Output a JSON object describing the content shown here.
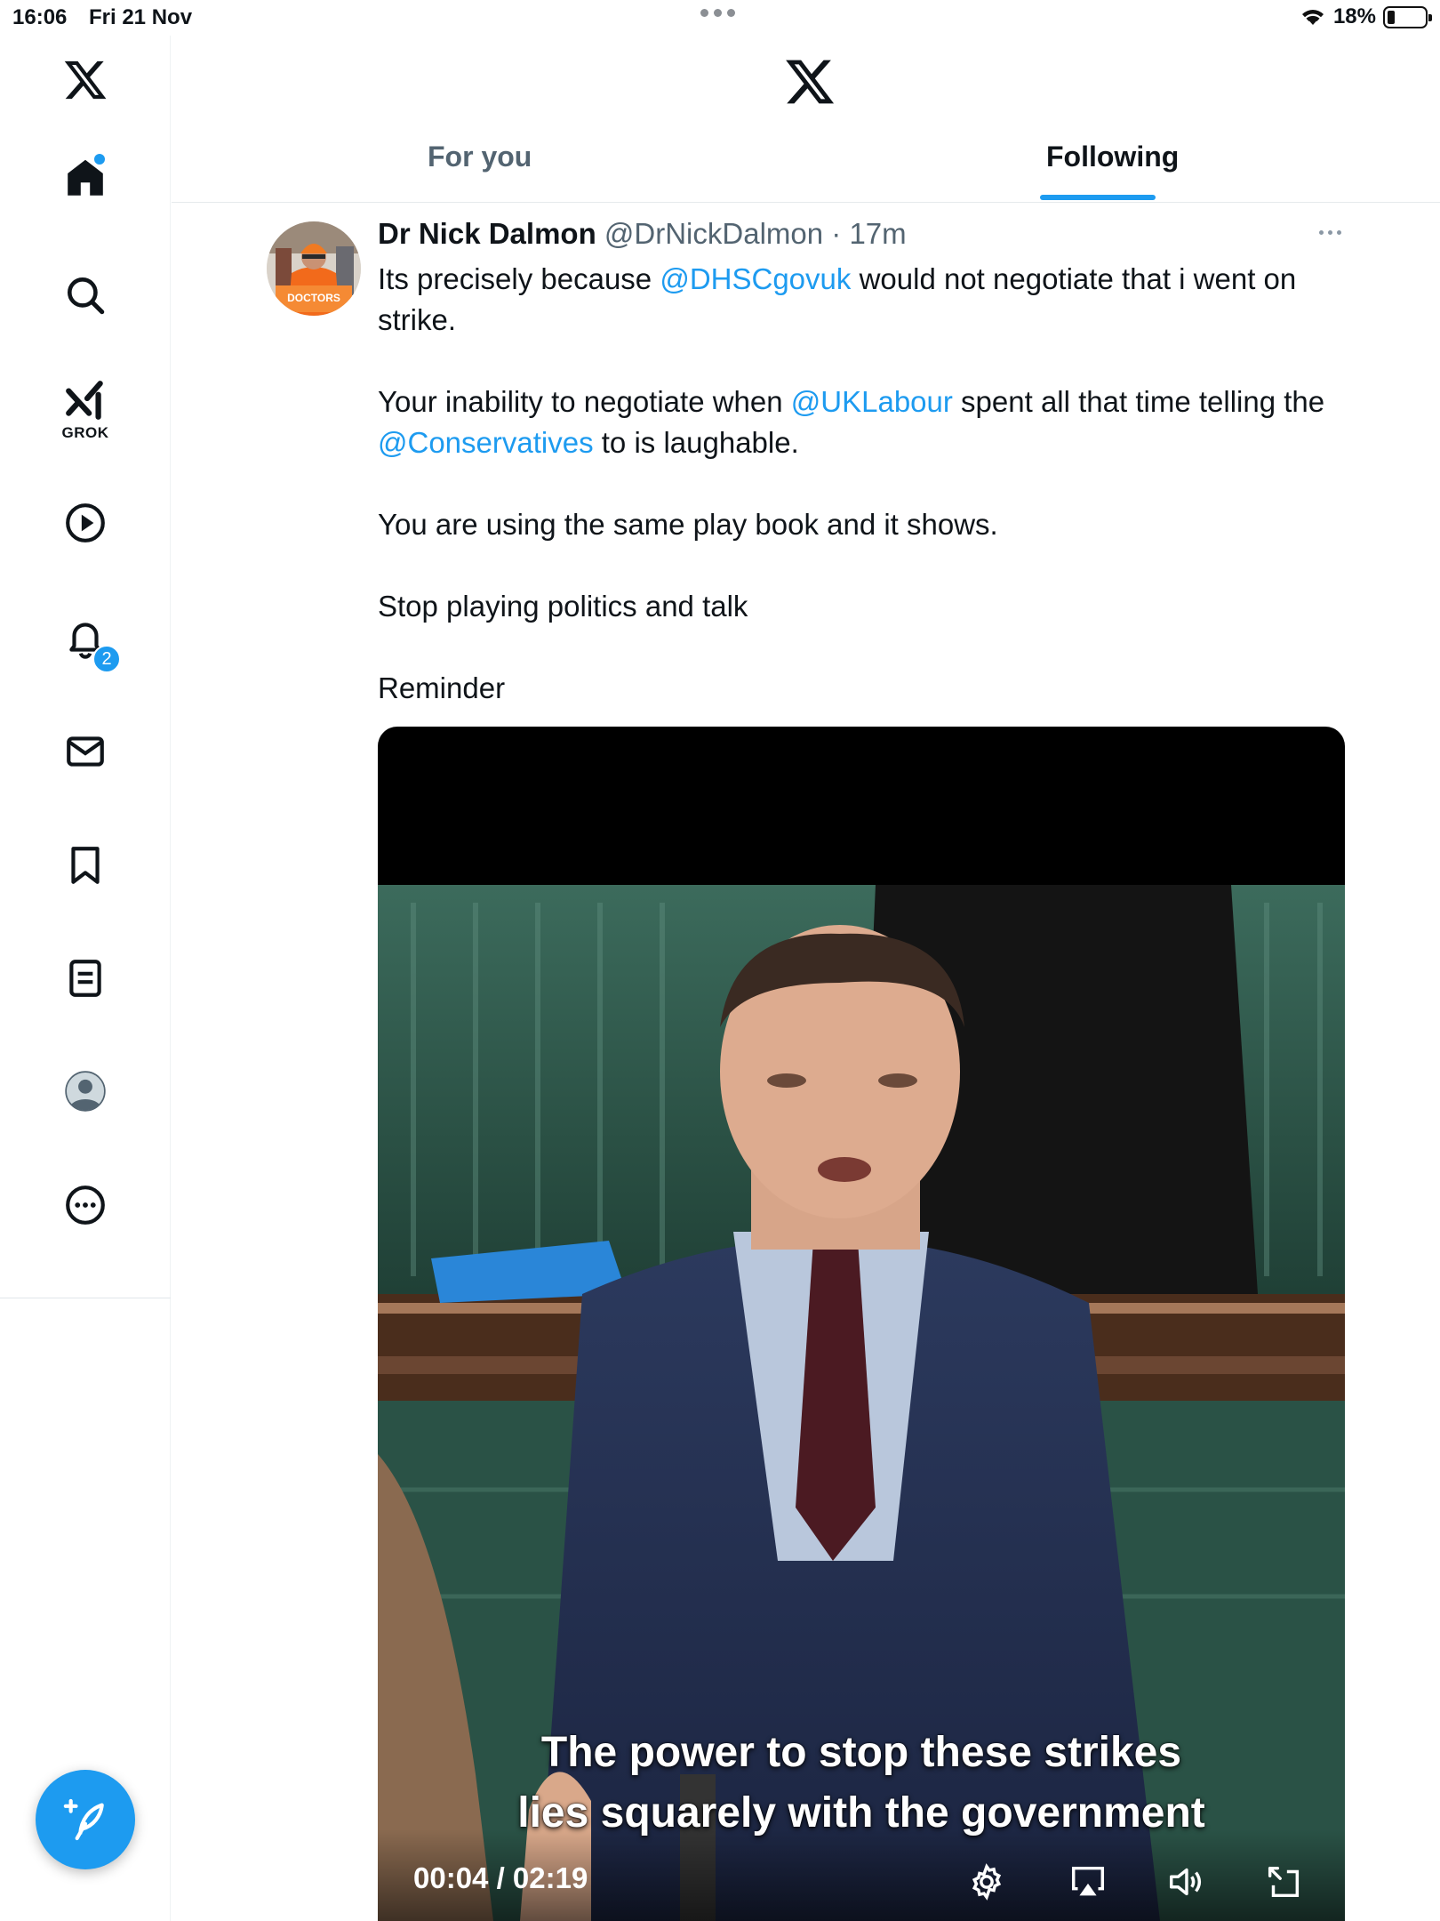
{
  "status_bar": {
    "time": "16:06",
    "date": "Fri 21 Nov",
    "battery": "18%"
  },
  "sidebar": {
    "grok_label": "GROK",
    "notification_count": "2"
  },
  "tabs": [
    {
      "label": "For you",
      "selected": false
    },
    {
      "label": "Following",
      "selected": true
    }
  ],
  "tweet": {
    "author_name": "Dr Nick Dalmon",
    "handle": "@DrNickDalmon",
    "separator": "·",
    "time": "17m",
    "text": {
      "p1_before": "Its precisely because ",
      "p1_mention": "@DHSCgovuk",
      "p1_after": " would not negotiate that i went on strike.",
      "p2_before": "Your inability to negotiate when ",
      "p2_mention1": "@UKLabour",
      "p2_middle": " spent all that time telling the ",
      "p2_mention2": "@Conservatives",
      "p2_after": " to is laughable.",
      "p3": "You are using the same play book and it shows.",
      "p4": "Stop playing politics and talk",
      "p5": "Reminder"
    },
    "avatar_sign_text": "DOCTORS",
    "video": {
      "caption_line1": "The power to stop these strikes",
      "caption_line2": "lies squarely with the government",
      "time": "00:04 / 02:19"
    }
  },
  "colors": {
    "accent": "#1d9bf0",
    "text_primary": "#0f1419",
    "text_secondary": "#536471",
    "bench_green": "#2c5548"
  }
}
